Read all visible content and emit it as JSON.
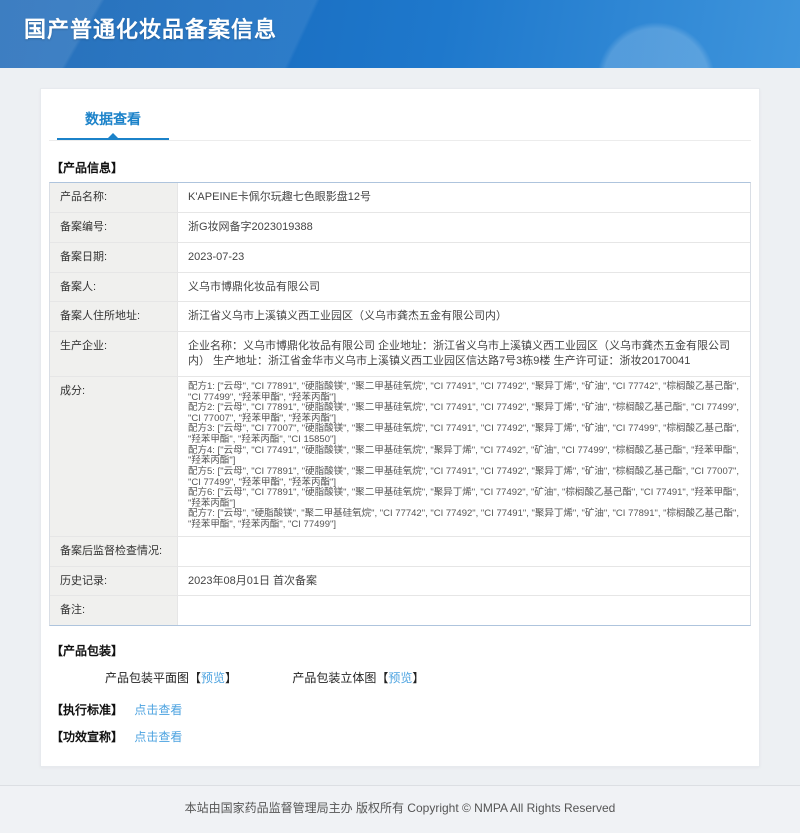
{
  "colors": {
    "banner_blue": "#1e78cc",
    "tab_blue": "#1b82c9",
    "link_blue": "#4da3e0"
  },
  "header": {
    "title": "国产普通化妆品备案信息"
  },
  "tabs": {
    "data_view": "数据查看"
  },
  "sections": {
    "product_info": "【产品信息】",
    "packaging": "【产品包装】",
    "standard": "【执行标准】",
    "efficacy": "【功效宣称】"
  },
  "product": {
    "rows": [
      {
        "label": "产品名称:",
        "value": "K'APEINE卡佩尔玩趣七色眼影盘12号"
      },
      {
        "label": "备案编号:",
        "value": "浙G妆网备字2023019388"
      },
      {
        "label": "备案日期:",
        "value": "2023-07-23"
      },
      {
        "label": "备案人:",
        "value": "义乌市博鼎化妆品有限公司"
      },
      {
        "label": "备案人住所地址:",
        "value": "浙江省义乌市上溪镇义西工业园区（义乌市龚杰五金有限公司内）"
      },
      {
        "label": "生产企业:",
        "value": "企业名称：义乌市博鼎化妆品有限公司 企业地址：浙江省义乌市上溪镇义西工业园区（义乌市龚杰五金有限公司内） 生产地址：浙江省金华市义乌市上溪镇义西工业园区信达路7号3栋9楼 生产许可证：浙妆20170041"
      },
      {
        "label": "成分:",
        "lines": [
          "配方1: [\"云母\", \"CI 77891\", \"硬脂酸镁\", \"聚二甲基硅氧烷\", \"CI 77491\", \"CI 77492\", \"聚异丁烯\", \"矿油\", \"CI 77742\", \"棕榈酸乙基己酯\", \"CI 77499\", \"羟苯甲酯\", \"羟苯丙酯\"]",
          "配方2: [\"云母\", \"CI 77891\", \"硬脂酸镁\", \"聚二甲基硅氧烷\", \"CI 77491\", \"CI 77492\", \"聚异丁烯\", \"矿油\", \"棕榈酸乙基己酯\", \"CI 77499\", \"CI 77007\", \"羟苯甲酯\", \"羟苯丙酯\"]",
          "配方3: [\"云母\", \"CI 77007\", \"硬脂酸镁\", \"聚二甲基硅氧烷\", \"CI 77491\", \"CI 77492\", \"聚异丁烯\", \"矿油\", \"CI 77499\", \"棕榈酸乙基己酯\", \"羟苯甲酯\", \"羟苯丙酯\", \"CI 15850\"]",
          "配方4: [\"云母\", \"CI 77491\", \"硬脂酸镁\", \"聚二甲基硅氧烷\", \"聚异丁烯\", \"CI 77492\", \"矿油\", \"CI 77499\", \"棕榈酸乙基己酯\", \"羟苯甲酯\", \"羟苯丙酯\"]",
          "配方5: [\"云母\", \"CI 77891\", \"硬脂酸镁\", \"聚二甲基硅氧烷\", \"CI 77491\", \"CI 77492\", \"聚异丁烯\", \"矿油\", \"棕榈酸乙基己酯\", \"CI 77007\", \"CI 77499\", \"羟苯甲酯\", \"羟苯丙酯\"]",
          "配方6: [\"云母\", \"CI 77891\", \"硬脂酸镁\", \"聚二甲基硅氧烷\", \"聚异丁烯\", \"CI 77492\", \"矿油\", \"棕榈酸乙基己酯\", \"CI 77491\", \"羟苯甲酯\", \"羟苯丙酯\"]",
          "配方7: [\"云母\", \"硬脂酸镁\", \"聚二甲基硅氧烷\", \"CI 77742\", \"CI 77492\", \"CI 77491\", \"聚异丁烯\", \"矿油\", \"CI 77891\", \"棕榈酸乙基己酯\", \"羟苯甲酯\", \"羟苯丙酯\", \"CI 77499\"]"
        ]
      },
      {
        "label": "备案后监督检查情况:",
        "value": ""
      },
      {
        "label": "历史记录:",
        "value": "2023年08月01日 首次备案"
      },
      {
        "label": "备注:",
        "value": ""
      }
    ]
  },
  "packaging": {
    "flat_prefix": "产品包装平面图【",
    "flat_link": "预览",
    "flat_suffix": "】",
    "stereo_prefix": "产品包装立体图【",
    "stereo_link": "预览",
    "stereo_suffix": "】"
  },
  "links": {
    "view_standard": "点击查看",
    "view_efficacy": "点击查看"
  },
  "footer": {
    "text": "本站由国家药品监督管理局主办 版权所有 Copyright © NMPA All Rights Reserved"
  }
}
